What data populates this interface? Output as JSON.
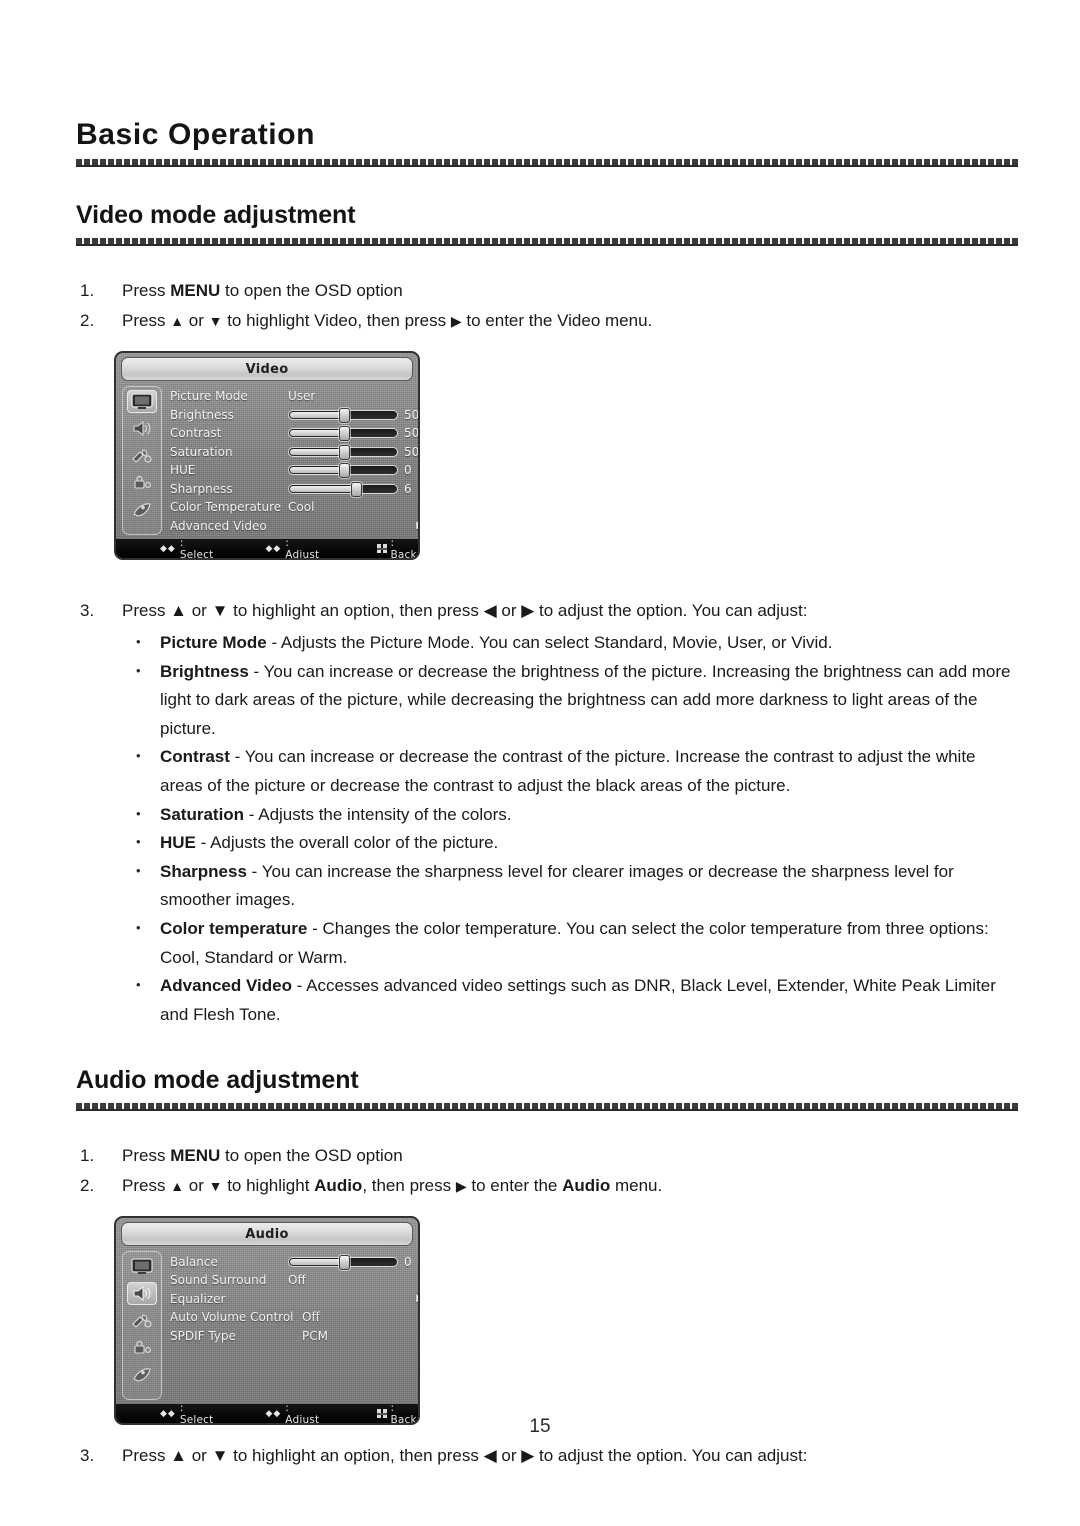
{
  "chapter": {
    "title": "Basic Operation"
  },
  "page_number": "15",
  "video_section": {
    "heading": "Video mode adjustment",
    "steps": [
      {
        "num": "1.",
        "parts": [
          {
            "t": "Press ",
            "b": false
          },
          {
            "t": "MENU",
            "b": true
          },
          {
            "t": " to open the OSD option",
            "b": false
          }
        ]
      },
      {
        "num": "2.",
        "parts": [
          {
            "t": "Press ",
            "b": false
          },
          {
            "t": "▲",
            "b": false
          },
          {
            "t": " or ",
            "b": false
          },
          {
            "t": "▼",
            "b": false
          },
          {
            "t": " to highlight Video, then press ",
            "b": false
          },
          {
            "t": "▶",
            "b": false
          },
          {
            "t": " to enter the Video menu.",
            "b": false
          }
        ]
      }
    ],
    "step3": {
      "num": "3.",
      "text": "Press ▲ or ▼ to highlight an option, then press ◀ or ▶ to adjust the option. You can adjust:"
    },
    "bullets": [
      {
        "term": "Picture Mode",
        "desc": " - Adjusts the Picture Mode. You can select Standard, Movie, User, or Vivid."
      },
      {
        "term": "Brightness",
        "desc": " - You can increase or decrease the brightness of the picture. Increasing the brightness can add more light to dark areas of the picture, while decreasing the brightness can add more darkness to light areas of the picture."
      },
      {
        "term": "Contrast",
        "desc": " - You can increase or decrease the contrast of the picture. Increase the contrast to adjust the white areas of the picture or decrease the contrast to adjust the black areas of the picture."
      },
      {
        "term": "Saturation",
        "desc": " - Adjusts the intensity of the colors."
      },
      {
        "term": "HUE",
        "desc": " - Adjusts the overall color of the picture."
      },
      {
        "term": "Sharpness",
        "desc": " - You can increase the sharpness level for clearer images or decrease the sharpness level for smoother images."
      },
      {
        "term": "Color temperature",
        "desc": " - Changes the color temperature. You can select the color temperature from three options: Cool, Standard or Warm."
      },
      {
        "term": "Advanced Video",
        "desc": " - Accesses advanced video settings such as DNR, Black Level, Extender, White Peak Limiter and Flesh Tone."
      }
    ]
  },
  "audio_section": {
    "heading": "Audio mode adjustment",
    "steps": [
      {
        "num": "1.",
        "text_plain": "Press MENU to open the OSD option"
      },
      {
        "num": "2.",
        "text_plain": "Press ▲ or ▼ to highlight Audio, then press ▶ to enter the Audio menu."
      }
    ],
    "step3": {
      "num": "3.",
      "text": "Press ▲ or ▼ to highlight an option, then press ◀ or ▶ to adjust the option. You can adjust:"
    }
  },
  "video_osd": {
    "title": "Video",
    "icons": [
      {
        "name": "video-screen-icon",
        "selected": true
      },
      {
        "name": "audio-speaker-icon",
        "selected": false
      },
      {
        "name": "setup-tools-icon",
        "selected": false
      },
      {
        "name": "lock-parental-icon",
        "selected": false
      },
      {
        "name": "channel-antenna-icon",
        "selected": false
      }
    ],
    "rows": [
      {
        "label": "Picture Mode",
        "type": "value",
        "value": "User"
      },
      {
        "label": "Brightness",
        "type": "slider",
        "value": "50",
        "percent": 50
      },
      {
        "label": "Contrast",
        "type": "slider",
        "value": "50",
        "percent": 50
      },
      {
        "label": "Saturation",
        "type": "slider",
        "value": "50",
        "percent": 50
      },
      {
        "label": "HUE",
        "type": "slider",
        "value": "0",
        "percent": 50
      },
      {
        "label": "Sharpness",
        "type": "slider",
        "value": "6",
        "percent": 62
      },
      {
        "label": "Color Temperature",
        "type": "value",
        "value": "Cool"
      },
      {
        "label": "Advanced Video",
        "type": "submenu",
        "value": "▶"
      }
    ],
    "footer": {
      "select": ": Select",
      "adjust": ": Adjust",
      "back": ": Back",
      "select_glyph": "⬍",
      "adjust_glyph": "⬌"
    }
  },
  "audio_osd": {
    "title": "Audio",
    "icons": [
      {
        "name": "video-screen-icon",
        "selected": false
      },
      {
        "name": "audio-speaker-icon",
        "selected": true
      },
      {
        "name": "setup-tools-icon",
        "selected": false
      },
      {
        "name": "lock-parental-icon",
        "selected": false
      },
      {
        "name": "channel-antenna-icon",
        "selected": false
      }
    ],
    "rows": [
      {
        "label": "Balance",
        "type": "slider",
        "value": "0",
        "percent": 50
      },
      {
        "label": "Sound Surround",
        "type": "value",
        "value": "Off"
      },
      {
        "label": "Equalizer",
        "type": "submenu",
        "value": "▶"
      },
      {
        "label": "Auto Volume Control",
        "type": "value",
        "value": "Off"
      },
      {
        "label": "SPDIF Type",
        "type": "value",
        "value": "PCM"
      }
    ],
    "footer": {
      "select": ": Select",
      "adjust": ": Adjust",
      "back": ": Back",
      "select_glyph": "⬍",
      "adjust_glyph": "⬌"
    }
  }
}
